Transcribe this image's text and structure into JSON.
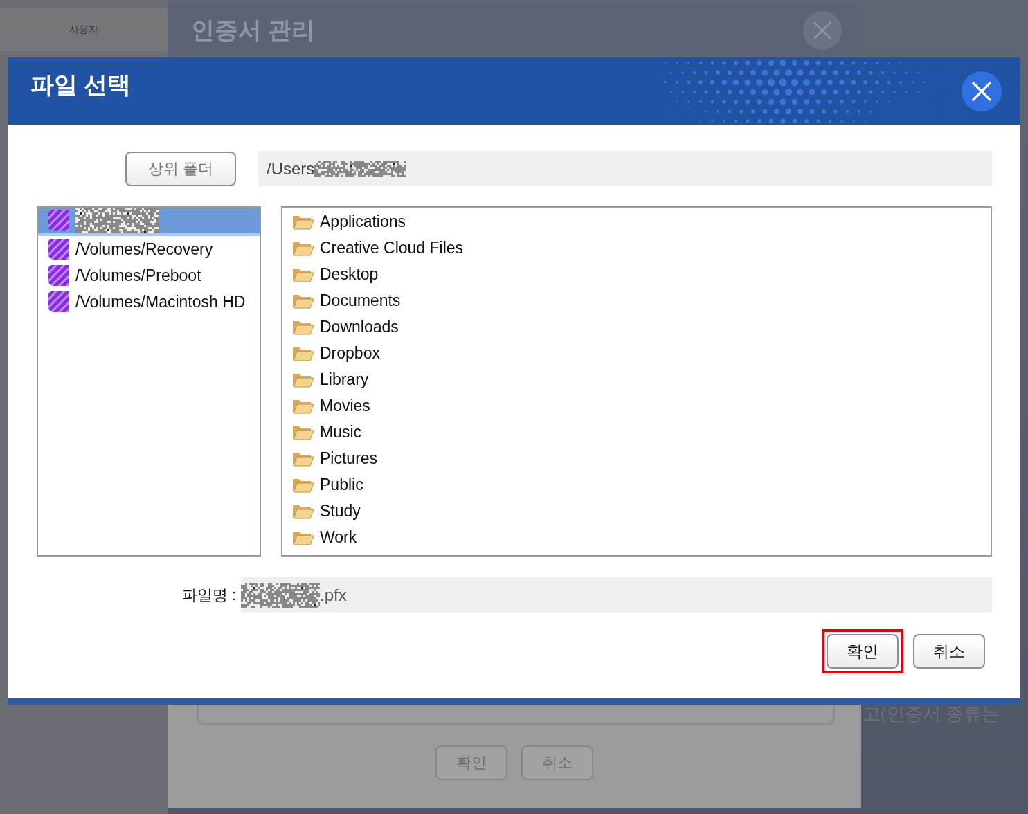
{
  "background": {
    "sidebar_label": "사용자",
    "dialog_title": "인증서 관리",
    "side_note": "고(인증서 종류는",
    "buttons": [
      "확인",
      "취소"
    ]
  },
  "dialog": {
    "title": "파일 선택",
    "up_button": "상위 폴더",
    "path": {
      "value": "/Users",
      "redacted_suffix": true
    },
    "volumes": [
      {
        "selected": true,
        "redacted": true
      },
      {
        "label": "/Volumes/Recovery",
        "selected": false,
        "redacted": false
      },
      {
        "label": "/Volumes/Preboot",
        "selected": false,
        "redacted": false
      },
      {
        "label": "/Volumes/Macintosh HD",
        "selected": false,
        "redacted": false
      }
    ],
    "folders": [
      "Applications",
      "Creative Cloud Files",
      "Desktop",
      "Documents",
      "Downloads",
      "Dropbox",
      "Library",
      "Movies",
      "Music",
      "Pictures",
      "Public",
      "Study",
      "Work"
    ],
    "filename": {
      "label": "파일명 :",
      "value": ".pfx",
      "redacted_prefix": true
    },
    "buttons": [
      {
        "label": "확인",
        "highlighted": true
      },
      {
        "label": "취소",
        "highlighted": false
      }
    ]
  }
}
